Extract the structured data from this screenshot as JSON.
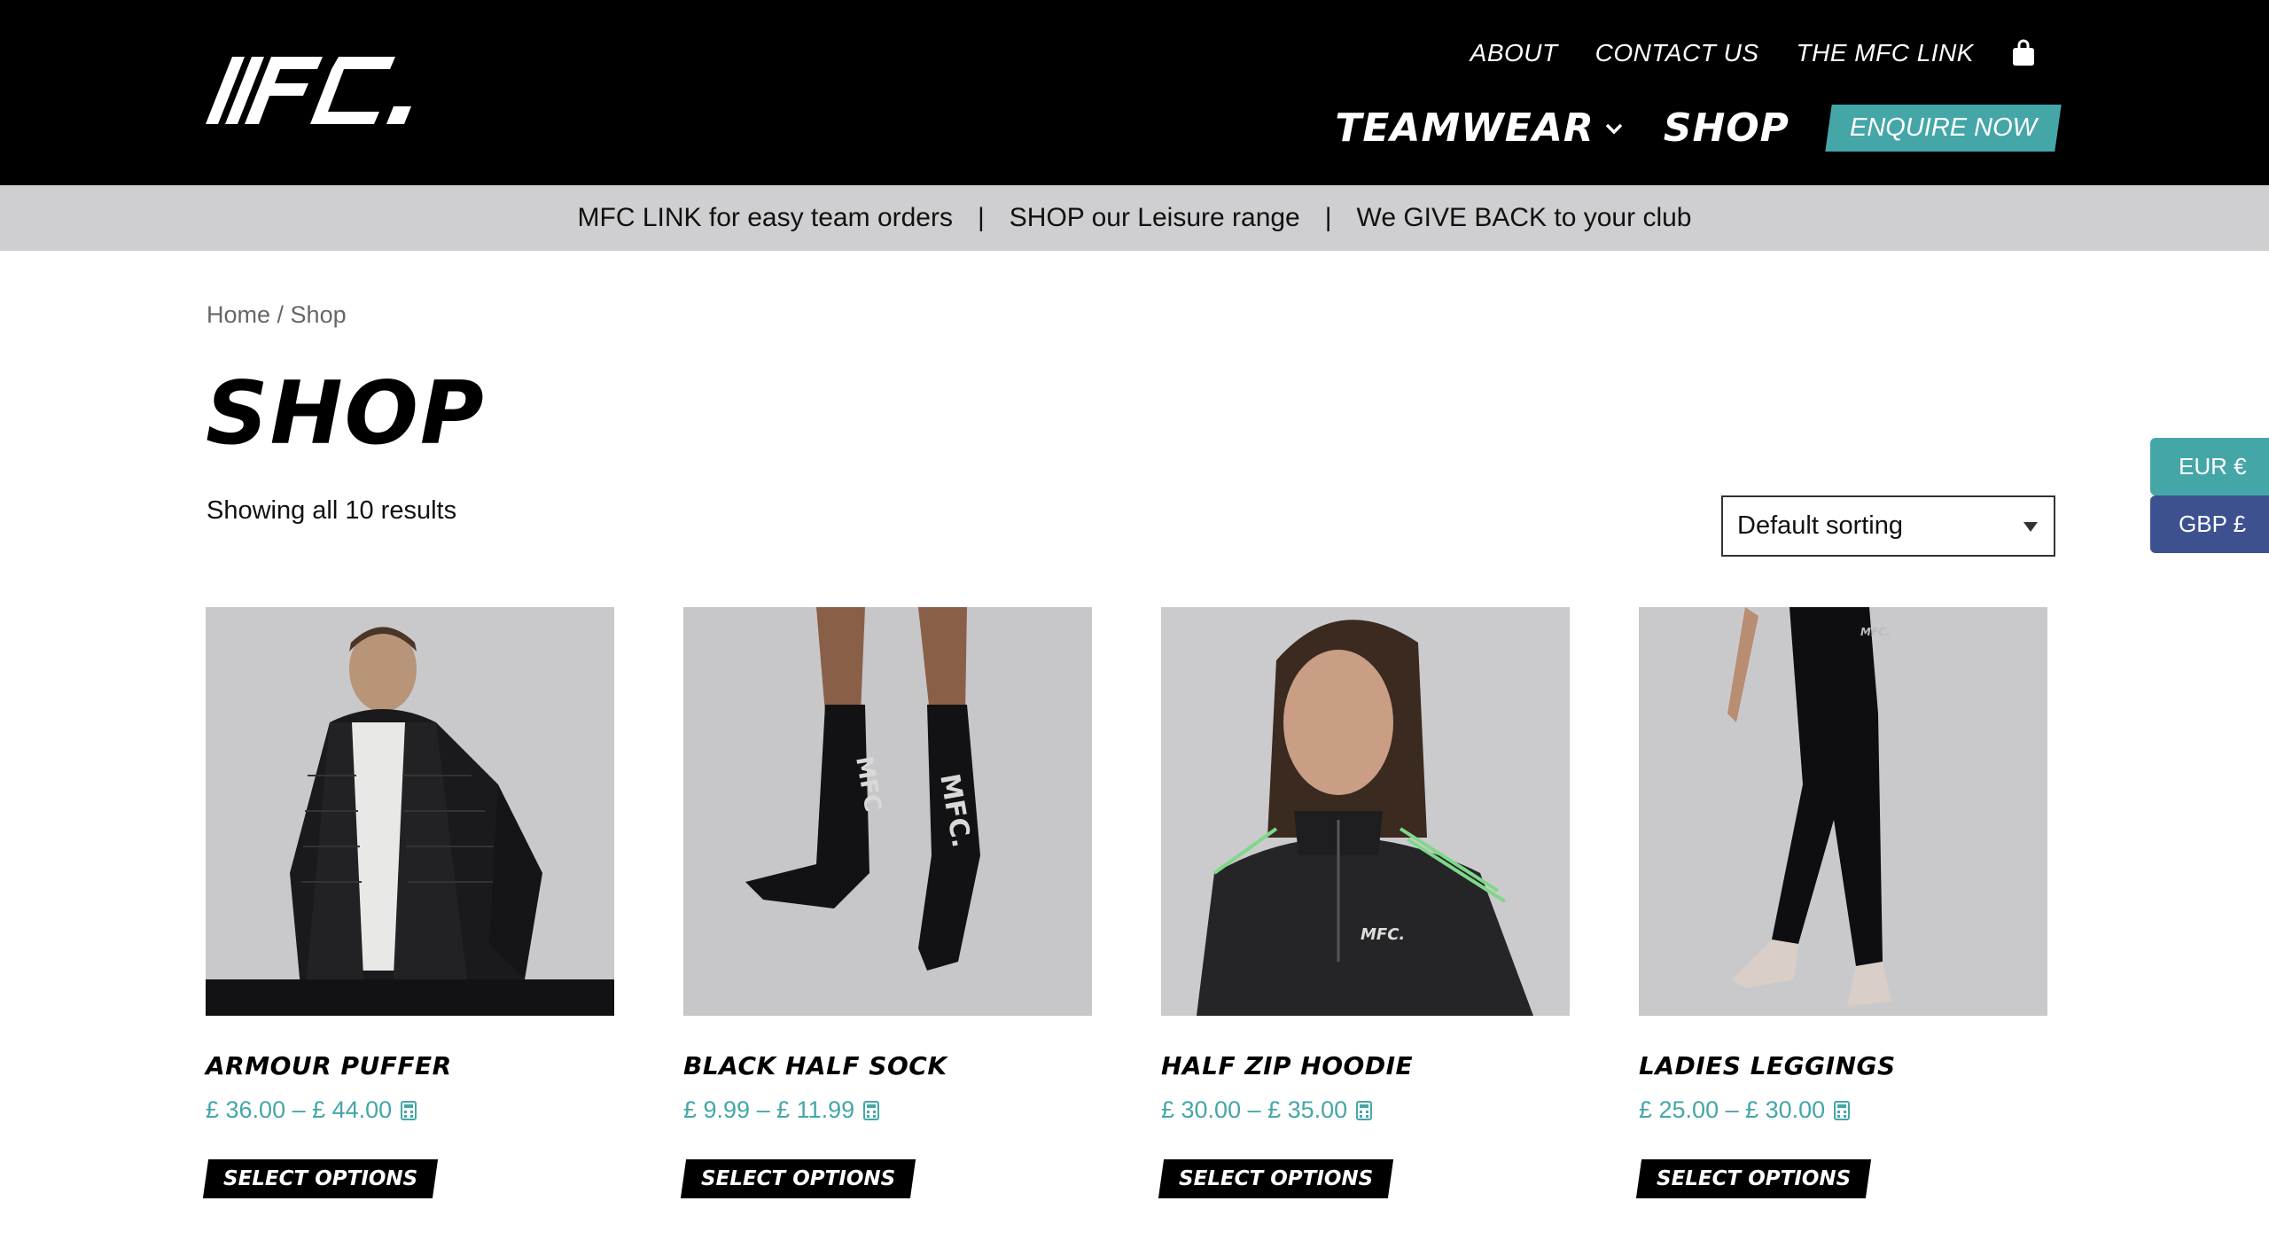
{
  "colors": {
    "header_bg": "#000000",
    "accent": "#45a6a8",
    "gbp": "#3d5191",
    "promo_bg": "#cfcfd1",
    "image_bg": "#c6c6c8"
  },
  "header": {
    "logo_text": "MFC.",
    "top_nav": [
      {
        "label": "ABOUT"
      },
      {
        "label": "CONTACT US"
      },
      {
        "label": "THE MFC LINK"
      }
    ],
    "cart_icon": "shopping-bag-icon",
    "main_nav": {
      "teamwear": "TEAMWEAR",
      "shop": "SHOP",
      "enquire": "ENQUIRE NOW"
    }
  },
  "promo": {
    "items": [
      "MFC LINK for easy team orders",
      "SHOP our Leisure range",
      "We GIVE BACK to your club"
    ],
    "separator": "|"
  },
  "breadcrumb": {
    "home": "Home",
    "separator": " / ",
    "current": "Shop"
  },
  "page": {
    "title": "SHOP",
    "result_count": "Showing all 10 results"
  },
  "sorting": {
    "selected": "Default sorting"
  },
  "currency": {
    "eur": "EUR €",
    "gbp": "GBP £"
  },
  "products": [
    {
      "name": "ARMOUR PUFFER",
      "price": "£ 36.00 – £ 44.00",
      "button": "SELECT OPTIONS",
      "image_icon": "puffer-jacket-image"
    },
    {
      "name": "BLACK HALF SOCK",
      "price": "£ 9.99 – £ 11.99",
      "button": "SELECT OPTIONS",
      "image_icon": "socks-image"
    },
    {
      "name": "HALF ZIP HOODIE",
      "price": "£ 30.00 – £ 35.00",
      "button": "SELECT OPTIONS",
      "image_icon": "hoodie-image"
    },
    {
      "name": "LADIES LEGGINGS",
      "price": "£ 25.00 – £ 30.00",
      "button": "SELECT OPTIONS",
      "image_icon": "leggings-image"
    }
  ]
}
